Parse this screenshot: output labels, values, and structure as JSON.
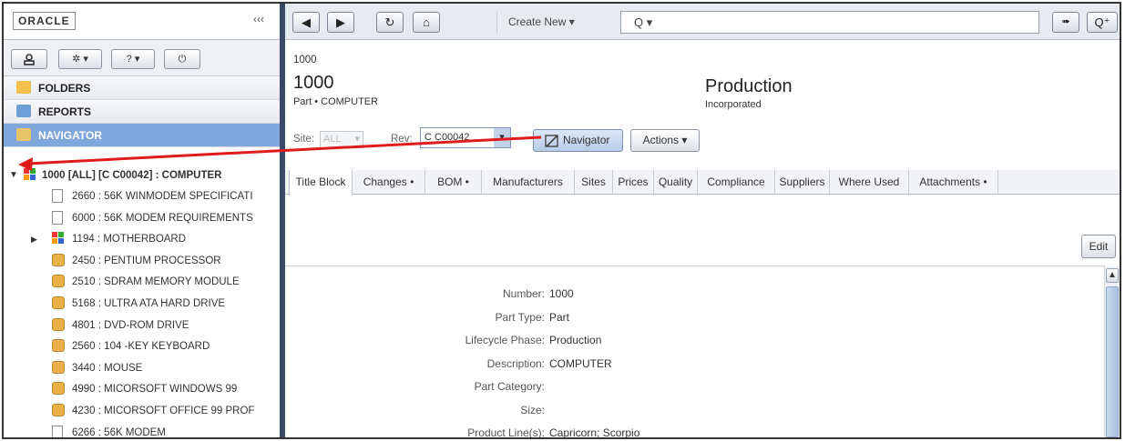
{
  "sidebar": {
    "logo": "ORACLE",
    "collapse_glyph": "‹‹‹",
    "toolbar": {
      "user_icon": "user-icon",
      "settings_icon": "gear-icon",
      "help_label": "?",
      "power_icon": "power-icon"
    },
    "nav": [
      {
        "label": "FOLDERS",
        "icon": "folder-icon"
      },
      {
        "label": "REPORTS",
        "icon": "reports-icon"
      },
      {
        "label": "NAVIGATOR",
        "icon": "navigator-icon",
        "active": true
      }
    ],
    "tree": {
      "root": "1000 [ALL] [C C00042] : COMPUTER",
      "items": [
        {
          "label": "2660 : 56K WINMODEM SPECIFICATI",
          "icon": "document"
        },
        {
          "label": "6000 : 56K MODEM REQUIREMENTS",
          "icon": "document"
        },
        {
          "label": "1194 : MOTHERBOARD",
          "icon": "assembly"
        },
        {
          "label": "2450 : PENTIUM PROCESSOR",
          "icon": "part"
        },
        {
          "label": "2510 : SDRAM MEMORY MODULE",
          "icon": "part"
        },
        {
          "label": "5168 : ULTRA ATA HARD DRIVE",
          "icon": "part"
        },
        {
          "label": "4801 : DVD-ROM DRIVE",
          "icon": "part"
        },
        {
          "label": "2560 : 104 -KEY KEYBOARD",
          "icon": "part"
        },
        {
          "label": "3440 : MOUSE",
          "icon": "part"
        },
        {
          "label": "4990 : MICORSOFT WINDOWS 99",
          "icon": "part"
        },
        {
          "label": "4230 : MICORSOFT OFFICE 99 PROF",
          "icon": "part"
        },
        {
          "label": "6266 : 56K MODEM",
          "icon": "document"
        }
      ]
    }
  },
  "toolbar": {
    "back": "◀",
    "forward": "▶",
    "refresh": "↻",
    "home": "⌂",
    "create_new": "Create New ▾",
    "search_glyph": "Q ▾",
    "go": "➠",
    "advanced_search": "Q⁺"
  },
  "header": {
    "breadcrumb": "1000",
    "number": "1000",
    "subtitle": "Part • COMPUTER",
    "status": "Production",
    "status_sub": "Incorporated",
    "site_label": "Site:",
    "site_value": "ALL",
    "rev_label": "Rev:",
    "rev_value": "C C00042",
    "navigator_button": "Navigator",
    "actions_button": "Actions ▾"
  },
  "tabs": [
    "Title Block",
    "Changes •",
    "BOM •",
    "Manufacturers",
    "Sites",
    "Prices",
    "Quality",
    "Compliance",
    "Suppliers",
    "Where Used",
    "Attachments •"
  ],
  "edit_button": "Edit",
  "fields": [
    {
      "label": "Number:",
      "value": "1000"
    },
    {
      "label": "Part Type:",
      "value": "Part"
    },
    {
      "label": "Lifecycle Phase:",
      "value": "Production"
    },
    {
      "label": "Description:",
      "value": "COMPUTER"
    },
    {
      "label": "Part Category:",
      "value": ""
    },
    {
      "label": "Size:",
      "value": ""
    },
    {
      "label": "Product Line(s):",
      "value": "Capricorn; Scorpio"
    }
  ],
  "colors": {
    "accent": "#7fa7dc",
    "annotation_arrow": "#e01b1b"
  }
}
